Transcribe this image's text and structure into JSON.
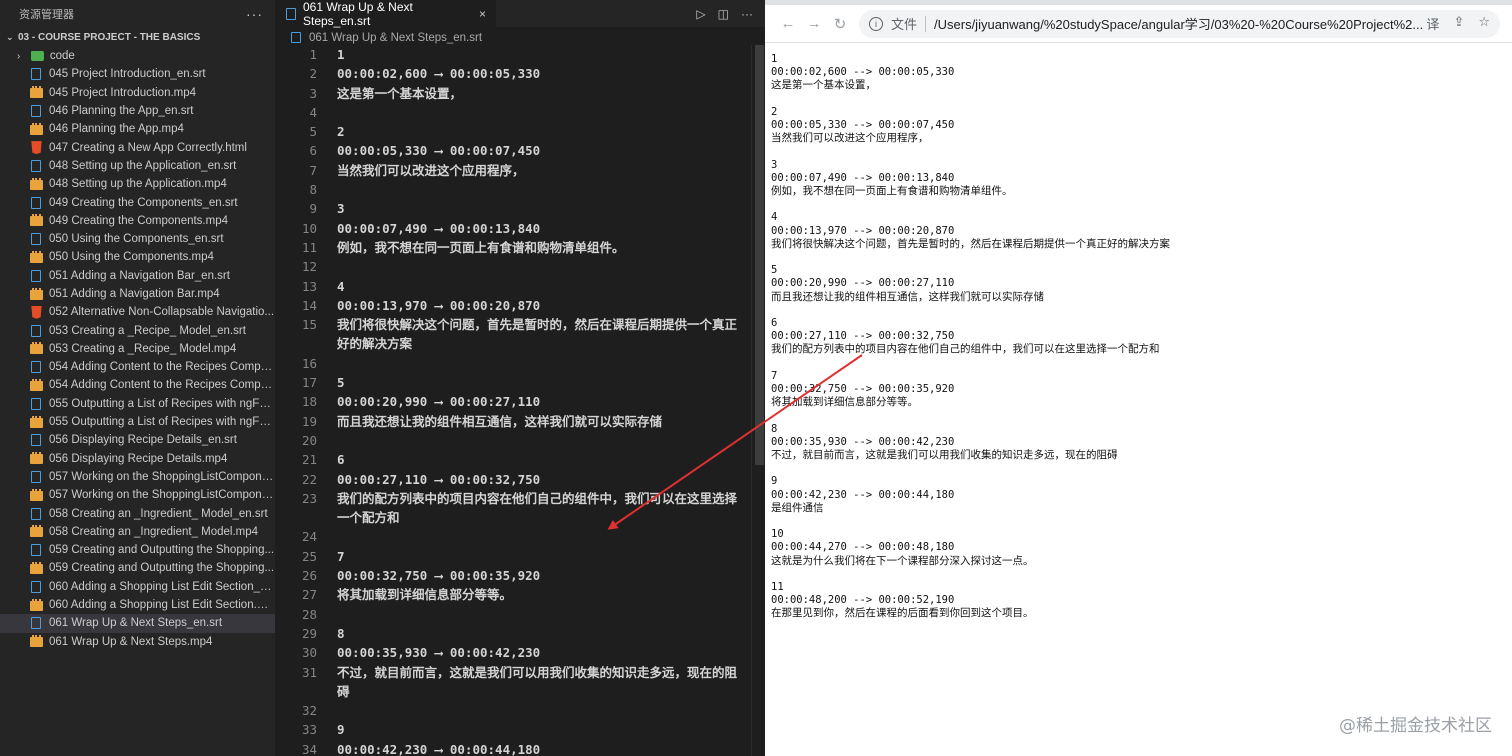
{
  "explorer": {
    "title": "资源管理器",
    "more": "···",
    "folder": "03 - COURSE PROJECT - THE BASICS",
    "items": [
      {
        "name": "code",
        "type": "folder"
      },
      {
        "name": "045 Project Introduction_en.srt",
        "type": "srt"
      },
      {
        "name": "045 Project Introduction.mp4",
        "type": "mp4"
      },
      {
        "name": "046 Planning the App_en.srt",
        "type": "srt"
      },
      {
        "name": "046 Planning the App.mp4",
        "type": "mp4"
      },
      {
        "name": "047 Creating a New App Correctly.html",
        "type": "html"
      },
      {
        "name": "048 Setting up the Application_en.srt",
        "type": "srt"
      },
      {
        "name": "048 Setting up the Application.mp4",
        "type": "mp4"
      },
      {
        "name": "049 Creating the Components_en.srt",
        "type": "srt"
      },
      {
        "name": "049 Creating the Components.mp4",
        "type": "mp4"
      },
      {
        "name": "050 Using the Components_en.srt",
        "type": "srt"
      },
      {
        "name": "050 Using the Components.mp4",
        "type": "mp4"
      },
      {
        "name": "051 Adding a Navigation Bar_en.srt",
        "type": "srt"
      },
      {
        "name": "051 Adding a Navigation Bar.mp4",
        "type": "mp4"
      },
      {
        "name": "052 Alternative Non-Collapsable Navigatio...",
        "type": "html"
      },
      {
        "name": "053 Creating a _Recipe_ Model_en.srt",
        "type": "srt"
      },
      {
        "name": "053 Creating a _Recipe_ Model.mp4",
        "type": "mp4"
      },
      {
        "name": "054 Adding Content to the Recipes Compo...",
        "type": "srt"
      },
      {
        "name": "054 Adding Content to the Recipes Compo...",
        "type": "mp4"
      },
      {
        "name": "055 Outputting a List of Recipes with ngFo...",
        "type": "srt"
      },
      {
        "name": "055 Outputting a List of Recipes with ngFo...",
        "type": "mp4"
      },
      {
        "name": "056 Displaying Recipe Details_en.srt",
        "type": "srt"
      },
      {
        "name": "056 Displaying Recipe Details.mp4",
        "type": "mp4"
      },
      {
        "name": "057 Working on the ShoppingListCompone...",
        "type": "srt"
      },
      {
        "name": "057 Working on the ShoppingListCompone...",
        "type": "mp4"
      },
      {
        "name": "058 Creating an _Ingredient_ Model_en.srt",
        "type": "srt"
      },
      {
        "name": "058 Creating an _Ingredient_ Model.mp4",
        "type": "mp4"
      },
      {
        "name": "059 Creating and Outputting the Shopping...",
        "type": "srt"
      },
      {
        "name": "059 Creating and Outputting the Shopping...",
        "type": "mp4"
      },
      {
        "name": "060 Adding a Shopping List Edit Section_e...",
        "type": "srt"
      },
      {
        "name": "060 Adding a Shopping List Edit Section.m...",
        "type": "mp4"
      },
      {
        "name": "061 Wrap Up & Next Steps_en.srt",
        "type": "srt",
        "selected": true
      },
      {
        "name": "061 Wrap Up & Next Steps.mp4",
        "type": "mp4"
      }
    ]
  },
  "editor": {
    "tab_title": "061 Wrap Up & Next Steps_en.srt",
    "close": "×",
    "breadcrumb": "061 Wrap Up & Next Steps_en.srt",
    "actions": [
      "▷",
      "◫",
      "···"
    ],
    "lines": [
      {
        "n": "1",
        "t": "1",
        "k": "ts"
      },
      {
        "n": "2",
        "t": "00:00:02,600 ⟶ 00:00:05,330",
        "k": "ts"
      },
      {
        "n": "3",
        "t": "这是第一个基本设置，",
        "k": "cjk"
      },
      {
        "n": "4",
        "t": "",
        "k": ""
      },
      {
        "n": "5",
        "t": "2",
        "k": "ts"
      },
      {
        "n": "6",
        "t": "00:00:05,330 ⟶ 00:00:07,450",
        "k": "ts"
      },
      {
        "n": "7",
        "t": "当然我们可以改进这个应用程序，",
        "k": "cjk"
      },
      {
        "n": "8",
        "t": "",
        "k": ""
      },
      {
        "n": "9",
        "t": "3",
        "k": "ts"
      },
      {
        "n": "10",
        "t": "00:00:07,490 ⟶ 00:00:13,840",
        "k": "ts"
      },
      {
        "n": "11",
        "t": "例如，我不想在同一页面上有食谱和购物清单组件。",
        "k": "cjk"
      },
      {
        "n": "12",
        "t": "",
        "k": ""
      },
      {
        "n": "13",
        "t": "4",
        "k": "ts"
      },
      {
        "n": "14",
        "t": "00:00:13,970 ⟶ 00:00:20,870",
        "k": "ts"
      },
      {
        "n": "15",
        "t": "我们将很快解决这个问题，首先是暂时的，然后在课程后期提供一个真正好的解决方案",
        "k": "cjk"
      },
      {
        "n": "16",
        "t": "",
        "k": ""
      },
      {
        "n": "17",
        "t": "5",
        "k": "ts"
      },
      {
        "n": "18",
        "t": "00:00:20,990 ⟶ 00:00:27,110",
        "k": "ts"
      },
      {
        "n": "19",
        "t": "而且我还想让我的组件相互通信，这样我们就可以实际存储",
        "k": "cjk"
      },
      {
        "n": "20",
        "t": "",
        "k": ""
      },
      {
        "n": "21",
        "t": "6",
        "k": "ts"
      },
      {
        "n": "22",
        "t": "00:00:27,110 ⟶ 00:00:32,750",
        "k": "ts"
      },
      {
        "n": "23",
        "t": "我们的配方列表中的项目内容在他们自己的组件中，我们可以在这里选择一个配方和",
        "k": "cjk"
      },
      {
        "n": "24",
        "t": "",
        "k": ""
      },
      {
        "n": "25",
        "t": "7",
        "k": "ts"
      },
      {
        "n": "26",
        "t": "00:00:32,750 ⟶ 00:00:35,920",
        "k": "ts"
      },
      {
        "n": "27",
        "t": "将其加载到详细信息部分等等。",
        "k": "cjk"
      },
      {
        "n": "28",
        "t": "",
        "k": ""
      },
      {
        "n": "29",
        "t": "8",
        "k": "ts"
      },
      {
        "n": "30",
        "t": "00:00:35,930 ⟶ 00:00:42,230",
        "k": "ts"
      },
      {
        "n": "31",
        "t": "不过，就目前而言，这就是我们可以用我们收集的知识走多远，现在的阻碍",
        "k": "cjk"
      },
      {
        "n": "32",
        "t": "",
        "k": ""
      },
      {
        "n": "33",
        "t": "9",
        "k": "ts"
      },
      {
        "n": "34",
        "t": "00:00:42,230 ⟶ 00:00:44,180",
        "k": "ts"
      }
    ]
  },
  "browser": {
    "back": "←",
    "forward": "→",
    "reload": "↻",
    "info": "i",
    "scheme": "文件",
    "url": "/Users/jiyuanwang/%20studySpace/angular学习/03%20-%20Course%20Project%2...",
    "icons": [
      "译",
      "⇪",
      "☆"
    ],
    "cues": [
      {
        "idx": "1",
        "time": "00:00:02,600 --> 00:00:05,330",
        "text": "这是第一个基本设置，"
      },
      {
        "idx": "2",
        "time": "00:00:05,330 --> 00:00:07,450",
        "text": "当然我们可以改进这个应用程序，"
      },
      {
        "idx": "3",
        "time": "00:00:07,490 --> 00:00:13,840",
        "text": "例如，我不想在同一页面上有食谱和购物清单组件。"
      },
      {
        "idx": "4",
        "time": "00:00:13,970 --> 00:00:20,870",
        "text": "我们将很快解决这个问题，首先是暂时的，然后在课程后期提供一个真正好的解决方案"
      },
      {
        "idx": "5",
        "time": "00:00:20,990 --> 00:00:27,110",
        "text": "而且我还想让我的组件相互通信，这样我们就可以实际存储"
      },
      {
        "idx": "6",
        "time": "00:00:27,110 --> 00:00:32,750",
        "text": "我们的配方列表中的项目内容在他们自己的组件中，我们可以在这里选择一个配方和"
      },
      {
        "idx": "7",
        "time": "00:00:32,750 --> 00:00:35,920",
        "text": "将其加载到详细信息部分等等。"
      },
      {
        "idx": "8",
        "time": "00:00:35,930 --> 00:00:42,230",
        "text": "不过，就目前而言，这就是我们可以用我们收集的知识走多远，现在的阻碍"
      },
      {
        "idx": "9",
        "time": "00:00:42,230 --> 00:00:44,180",
        "text": "是组件通信"
      },
      {
        "idx": "10",
        "time": "00:00:44,270 --> 00:00:48,180",
        "text": "这就是为什么我们将在下一个课程部分深入探讨这一点。"
      },
      {
        "idx": "11",
        "time": "00:00:48,200 --> 00:00:52,190",
        "text": "在那里见到你，然后在课程的后面看到你回到这个项目。"
      }
    ],
    "watermark": "@稀土掘金技术社区"
  },
  "colors": {
    "arrow": "#e03131",
    "selection": "#37373d"
  }
}
